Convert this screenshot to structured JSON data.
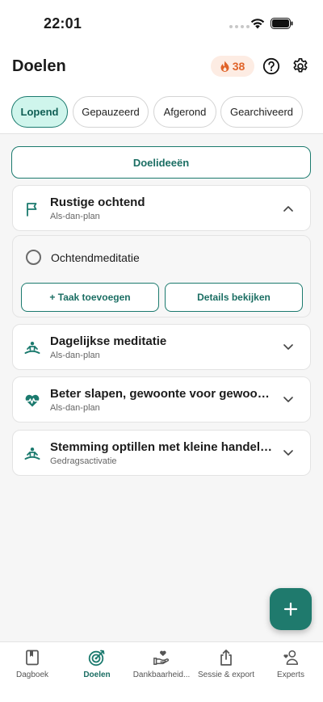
{
  "status_bar": {
    "time": "22:01"
  },
  "header": {
    "title": "Doelen",
    "streak_count": "38",
    "streak_icon": "flame-icon",
    "help_icon": "help-icon",
    "settings_icon": "gear-icon"
  },
  "tabs": [
    {
      "label": "Lopend",
      "active": true
    },
    {
      "label": "Gepauzeerd",
      "active": false
    },
    {
      "label": "Afgerond",
      "active": false
    },
    {
      "label": "Gearchiveerd",
      "active": false
    }
  ],
  "ideas_button": "Doelideeën",
  "goals": [
    {
      "title": "Rustige ochtend",
      "subtitle": "Als-dan-plan",
      "icon": "flag-icon",
      "expanded": true
    },
    {
      "title": "Dagelijkse meditatie",
      "subtitle": "Als-dan-plan",
      "icon": "meditation-icon",
      "expanded": false
    },
    {
      "title": "Beter slapen, gewoonte voor gewoonte",
      "subtitle": "Als-dan-plan",
      "icon": "heartbeat-icon",
      "expanded": false
    },
    {
      "title": "Stemming optillen met kleine handeli...",
      "subtitle": "Gedragsactivatie",
      "icon": "meditation-icon",
      "expanded": false
    }
  ],
  "expanded_goal": {
    "task": "Ochtendmeditatie",
    "add_task": "+ Taak toevoegen",
    "details": "Details bekijken"
  },
  "fab_icon": "plus-icon",
  "bottom_nav": [
    {
      "label": "Dagboek",
      "icon": "book-icon",
      "active": false
    },
    {
      "label": "Doelen",
      "icon": "target-icon",
      "active": true
    },
    {
      "label": "Dankbaarheid...",
      "icon": "gratitude-icon",
      "active": false
    },
    {
      "label": "Sessie & export",
      "icon": "share-icon",
      "active": false
    },
    {
      "label": "Experts",
      "icon": "experts-icon",
      "active": false
    }
  ],
  "colors": {
    "accent": "#1b7a6e",
    "accent_light": "#cff5ec",
    "streak": "#e0642a",
    "background": "#f6f6f6"
  }
}
